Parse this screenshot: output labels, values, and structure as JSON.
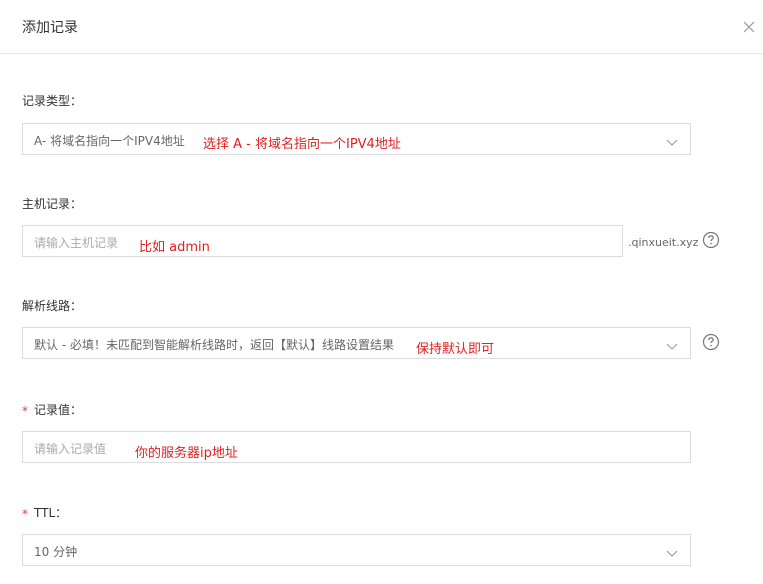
{
  "dialog": {
    "title": "添加记录"
  },
  "fields": {
    "record_type": {
      "label": "记录类型：",
      "value": "A- 将域名指向一个IPV4地址",
      "annotation": "选择 A - 将域名指向一个IPV4地址"
    },
    "host_record": {
      "label": "主机记录：",
      "placeholder": "请输入主机记录",
      "suffix": ".qinxueit.xyz",
      "annotation": "比如 admin"
    },
    "line": {
      "label": "解析线路：",
      "value": "默认 - 必填！未匹配到智能解析线路时，返回【默认】线路设置结果",
      "annotation": "保持默认即可"
    },
    "record_value": {
      "required_mark": "*",
      "label": "记录值：",
      "placeholder": "请输入记录值",
      "annotation": "你的服务器ip地址"
    },
    "ttl": {
      "required_mark": "*",
      "label": "TTL：",
      "value": "10 分钟"
    }
  },
  "icons": {
    "close": "close-icon",
    "dropdown": "chevron-down-icon",
    "help": "help-circle-icon"
  },
  "colors": {
    "annotation": "#e02020",
    "required": "#e4393c",
    "border": "#dcdcdc"
  }
}
